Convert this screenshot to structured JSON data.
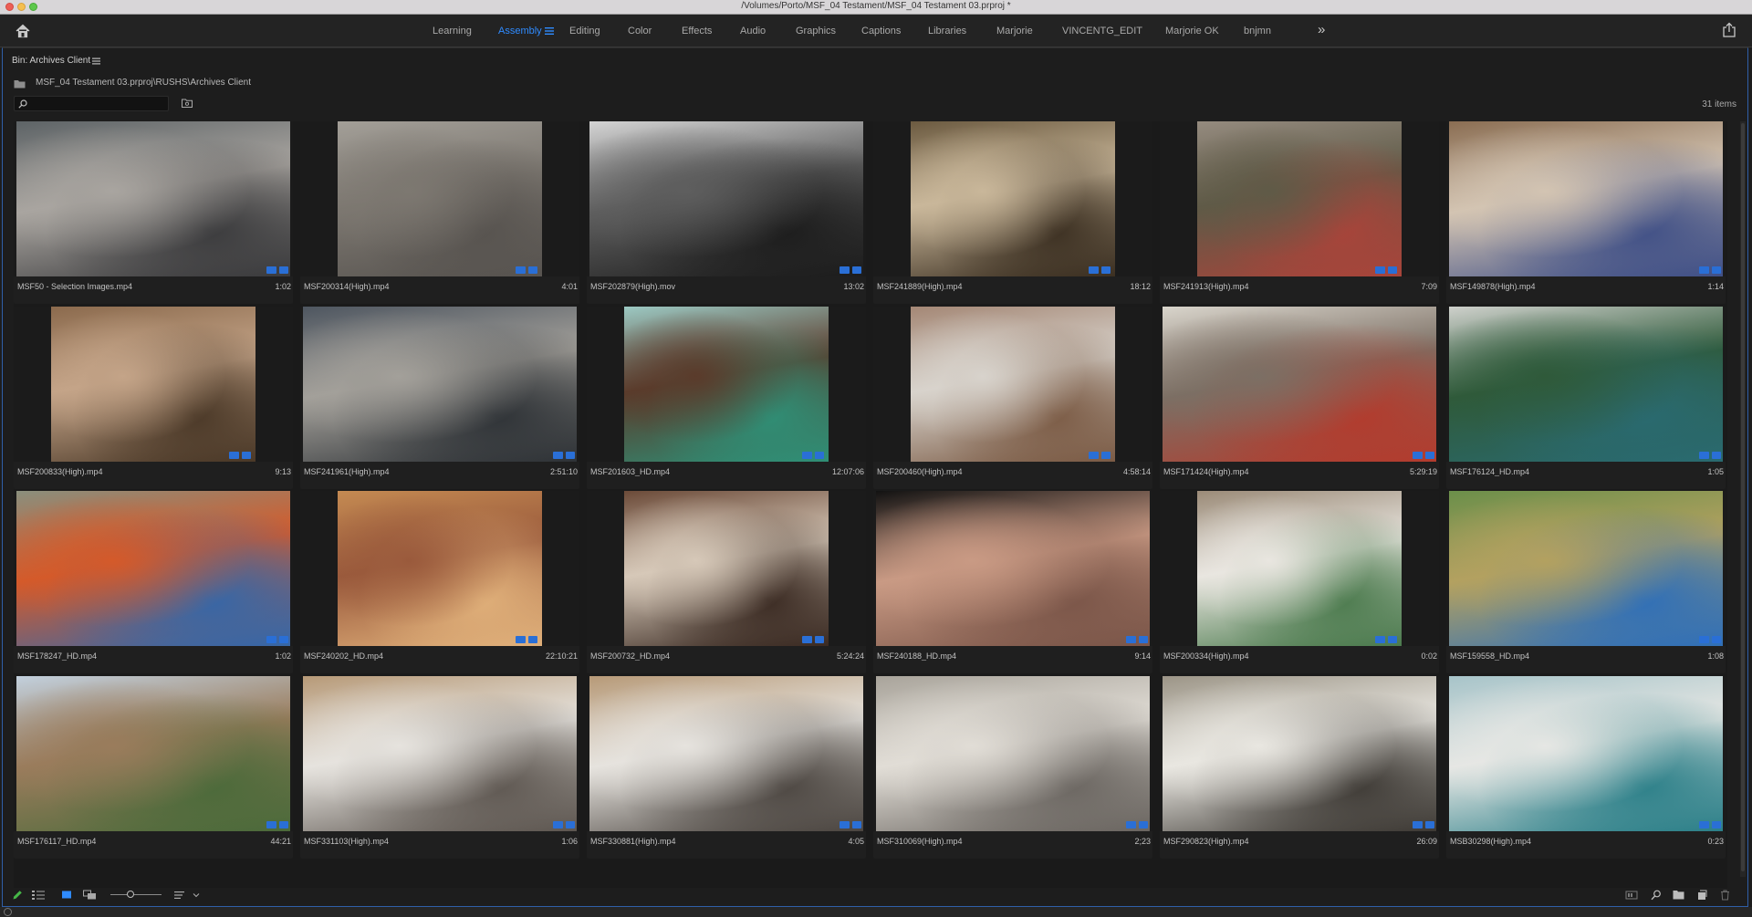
{
  "window": {
    "title": "/Volumes/Porto/MSF_04 Testament/MSF_04 Testament 03.prproj *"
  },
  "workspaces": {
    "tabs": [
      {
        "label": "Learning",
        "active": false
      },
      {
        "label": "Assembly",
        "active": true
      },
      {
        "label": "Editing",
        "active": false
      },
      {
        "label": "Color",
        "active": false
      },
      {
        "label": "Effects",
        "active": false
      },
      {
        "label": "Audio",
        "active": false
      },
      {
        "label": "Graphics",
        "active": false
      },
      {
        "label": "Captions",
        "active": false
      },
      {
        "label": "Libraries",
        "active": false
      },
      {
        "label": "Marjorie",
        "active": false
      },
      {
        "label": "VINCENTG_EDIT",
        "active": false
      },
      {
        "label": "Marjorie OK",
        "active": false
      },
      {
        "label": "bnjmn",
        "active": false
      }
    ],
    "more_label": "»",
    "accent_color": "#2f8bff"
  },
  "bin": {
    "title": "Bin: Archives Client",
    "path": "MSF_04 Testament 03.prproj\\RUSHS\\Archives Client",
    "search_placeholder": "",
    "item_count": "31 items"
  },
  "clips": [
    {
      "name": "MSF50 - Selection Images.mp4",
      "duration": "1:02",
      "palette": [
        "#5d6366",
        "#a9a5a0",
        "#3a3a3c"
      ],
      "style": "wide"
    },
    {
      "name": "MSF200314(High).mp4",
      "duration": "4:01",
      "palette": [
        "#a39f98",
        "#7d7871",
        "#57534f"
      ],
      "style": "narrow"
    },
    {
      "name": "MSF202879(High).mov",
      "duration": "13:02",
      "palette": [
        "#d4d4d4",
        "#5e5e5e",
        "#1c1c1c"
      ],
      "style": "wide"
    },
    {
      "name": "MSF241889(High).mp4",
      "duration": "18:12",
      "palette": [
        "#6b5a40",
        "#c9b79a",
        "#3b2f21"
      ],
      "style": "narrow"
    },
    {
      "name": "MSF241913(High).mp4",
      "duration": "7:09",
      "palette": [
        "#958b7f",
        "#5f5a47",
        "#a8443a"
      ],
      "style": "narrow"
    },
    {
      "name": "MSF149878(High).mp4",
      "duration": "1:14",
      "palette": [
        "#8a6d52",
        "#d3c4b2",
        "#3f4f86"
      ],
      "style": "wide"
    },
    {
      "name": "MSF200833(High).mp4",
      "duration": "9:13",
      "palette": [
        "#8b6a4d",
        "#c4a488",
        "#4a3827"
      ],
      "style": "narrow"
    },
    {
      "name": "MSF241961(High).mp4",
      "duration": "2:51:10",
      "palette": [
        "#4e5660",
        "#a3a09a",
        "#2e3236"
      ],
      "style": "wide"
    },
    {
      "name": "MSF201603_HD.mp4",
      "duration": "12:07:06",
      "palette": [
        "#9cc9c3",
        "#5a3b2b",
        "#2f8f76"
      ],
      "style": "narrow"
    },
    {
      "name": "MSF200460(High).mp4",
      "duration": "4:58:14",
      "palette": [
        "#a48775",
        "#d8d3cc",
        "#7b5b45"
      ],
      "style": "narrow"
    },
    {
      "name": "MSF171424(High).mp4",
      "duration": "5:29:19",
      "palette": [
        "#d9d5cc",
        "#7c6f64",
        "#b33b2d"
      ],
      "style": "wide"
    },
    {
      "name": "MSF176124_HD.mp4",
      "duration": "1:05",
      "palette": [
        "#cfd1cc",
        "#2f5a3a",
        "#2a6a70"
      ],
      "style": "wide"
    },
    {
      "name": "MSF178247_HD.mp4",
      "duration": "1:02",
      "palette": [
        "#8a8f7d",
        "#d45a2a",
        "#3567a8"
      ],
      "style": "wide"
    },
    {
      "name": "MSF240202_HD.mp4",
      "duration": "22:10:21",
      "palette": [
        "#c48a52",
        "#9a5a3c",
        "#e0b07a"
      ],
      "style": "narrow"
    },
    {
      "name": "MSF200732_HD.mp4",
      "duration": "5:24:24",
      "palette": [
        "#6b4a38",
        "#d6c8b8",
        "#3a2a22"
      ],
      "style": "narrow"
    },
    {
      "name": "MSF240188_HD.mp4",
      "duration": "9:14",
      "palette": [
        "#121212",
        "#c99a84",
        "#7a5548"
      ],
      "style": "wide"
    },
    {
      "name": "MSF200334(High).mp4",
      "duration": "0:02",
      "palette": [
        "#9b8b78",
        "#e9e6e0",
        "#4b7a4d"
      ],
      "style": "narrow"
    },
    {
      "name": "MSF159558_HD.mp4",
      "duration": "1:08",
      "palette": [
        "#6b8f4a",
        "#b3a160",
        "#2f6fb8"
      ],
      "style": "wide"
    },
    {
      "name": "MSF176117_HD.mp4",
      "duration": "44:21",
      "palette": [
        "#c2d0dd",
        "#9a7c5c",
        "#4b6a3a"
      ],
      "style": "wide"
    },
    {
      "name": "MSF331103(High).mp4",
      "duration": "1:06",
      "palette": [
        "#b79a78",
        "#e6e3de",
        "#5d5650"
      ],
      "style": "wide"
    },
    {
      "name": "MSF330881(High).mp4",
      "duration": "4:05",
      "palette": [
        "#b79a78",
        "#e6e3de",
        "#4b4540"
      ],
      "style": "wide"
    },
    {
      "name": "MSF310069(High).mp4",
      "duration": "2;23",
      "palette": [
        "#a9a49b",
        "#e1ddd6",
        "#6a6560"
      ],
      "style": "wide"
    },
    {
      "name": "MSF290823(High).mp4",
      "duration": "26:09",
      "palette": [
        "#9c9587",
        "#e9e7e1",
        "#3d3934"
      ],
      "style": "wide"
    },
    {
      "name": "MSB30298(High).mp4",
      "duration": "0:23",
      "palette": [
        "#a7c4c9",
        "#e6e7e4",
        "#2b7f88"
      ],
      "style": "wide"
    }
  ],
  "bottom_toolbar": {
    "icons": [
      "pencil-icon",
      "list-view-icon",
      "icon-view-icon",
      "freeform-view-icon",
      "zoom-slider",
      "sort-icon",
      "automate-icon",
      "find-icon",
      "new-bin-icon",
      "new-item-icon",
      "trash-icon"
    ],
    "zoom_level": 0.4
  }
}
